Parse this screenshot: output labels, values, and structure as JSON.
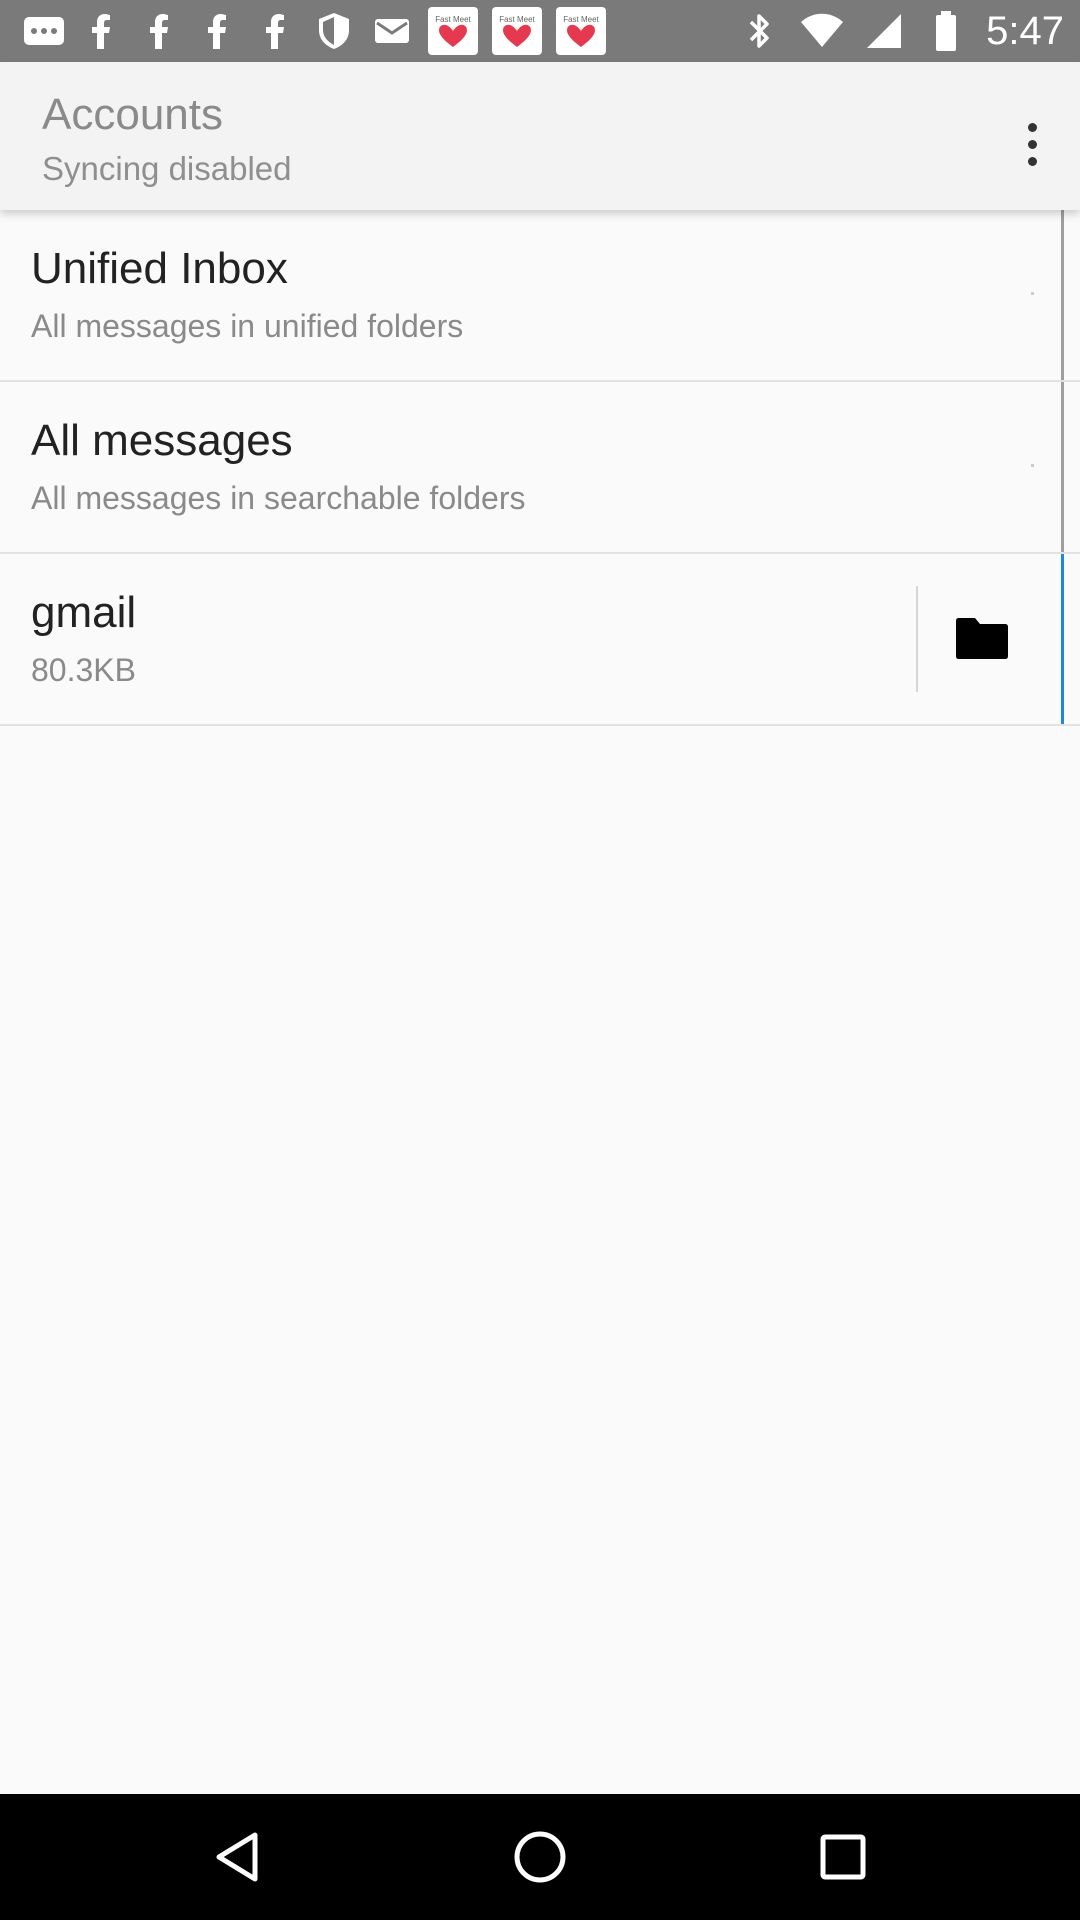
{
  "status_bar": {
    "time": "5:47",
    "fast_meet_label": "Fast Meet",
    "left_icons": [
      "more-icon",
      "facebook-icon",
      "facebook-icon",
      "facebook-icon",
      "facebook-icon",
      "shield-icon",
      "mail-icon",
      "fast-meet-icon",
      "fast-meet-icon",
      "fast-meet-icon"
    ],
    "right_icons": [
      "bluetooth-icon",
      "wifi-icon",
      "signal-icon",
      "battery-icon"
    ]
  },
  "app_bar": {
    "title": "Accounts",
    "subtitle": "Syncing disabled"
  },
  "accounts": [
    {
      "title": "Unified Inbox",
      "subtitle": "All messages in unified folders"
    },
    {
      "title": "All messages",
      "subtitle": "All messages in searchable folders"
    },
    {
      "title": "gmail",
      "subtitle": "80.3KB"
    }
  ],
  "colors": {
    "accent": "#1e88e5",
    "status_bar": "#7a7a7a",
    "app_bar": "#f3f3f3",
    "background": "#fafafa"
  },
  "nav_bar": {
    "icons": [
      "back-icon",
      "home-icon",
      "recents-icon"
    ]
  }
}
